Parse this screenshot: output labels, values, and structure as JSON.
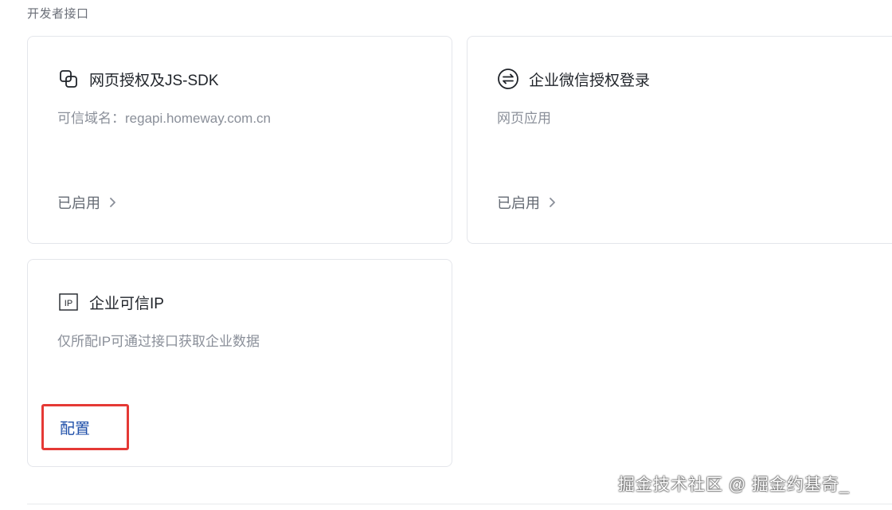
{
  "section": {
    "title": "开发者接口"
  },
  "cards": [
    {
      "title": "网页授权及JS-SDK",
      "icon": "link-copy-icon",
      "description": "可信域名：regapi.homeway.com.cn",
      "status": "已启用"
    },
    {
      "title": "企业微信授权登录",
      "icon": "exchange-circle-icon",
      "description": "网页应用",
      "status": "已启用"
    },
    {
      "title": "企业可信IP",
      "icon": "ip-box-icon",
      "icon_text": "IP",
      "description": "仅所配IP可通过接口获取企业数据",
      "action": "配置"
    }
  ],
  "colors": {
    "highlight_border": "#e53935",
    "link": "#1d4ea8"
  },
  "watermark": "掘金技术社区 @ 掘金约基奇_"
}
